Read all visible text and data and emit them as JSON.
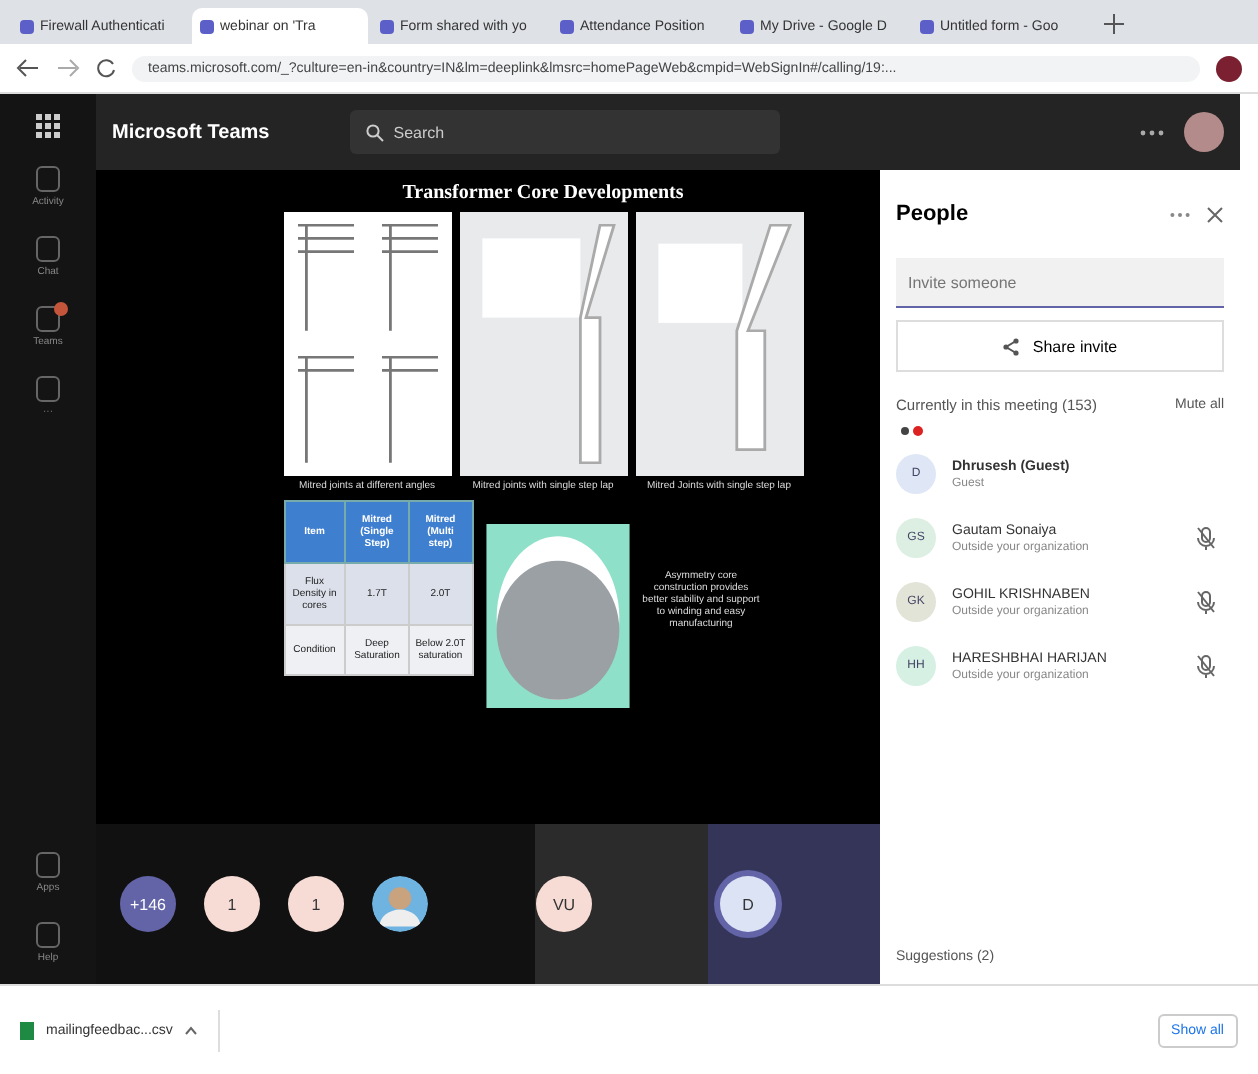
{
  "browser": {
    "tabs": [
      {
        "title": "Firewall Authenticati",
        "selected": false
      },
      {
        "title": "webinar on 'Tra",
        "selected": true
      },
      {
        "title": "Form shared with yo",
        "selected": false
      },
      {
        "title": "Attendance Position",
        "selected": false
      },
      {
        "title": "My Drive - Google D",
        "selected": false
      },
      {
        "title": "Untitled form - Goo",
        "selected": false
      }
    ],
    "url": "teams.microsoft.com/_?culture=en-in&country=IN&lm=deeplink&lmsrc=homePageWeb&cmpid=WebSignIn#/calling/19:..."
  },
  "app": {
    "name": "Microsoft Teams",
    "search_placeholder": "Search"
  },
  "rail": [
    {
      "label": "Activity",
      "badge": false
    },
    {
      "label": "Chat",
      "badge": false
    },
    {
      "label": "Teams",
      "badge": true
    },
    {
      "label": "···",
      "badge": false
    }
  ],
  "rail_bottom": [
    {
      "label": "Apps"
    },
    {
      "label": "Help"
    }
  ],
  "slide": {
    "title": "Transformer Core Developments",
    "captions": [
      "Mitred joints at different angles",
      "Mitred joints with single step lap",
      "Mitred Joints with single step lap"
    ],
    "table": {
      "columns": [
        "Item",
        "Mitred (Single Step)",
        "Mitred (Multi step)"
      ],
      "rows": [
        [
          "Flux Density in cores",
          "1.7T",
          "2.0T"
        ],
        [
          "Condition",
          "Deep Saturation",
          "Below 2.0T saturation"
        ]
      ]
    },
    "note": "Asymmetry core construction provides better stability and support to winding and easy manufacturing"
  },
  "tiles": [
    {
      "kind": "count",
      "text": "+146"
    },
    {
      "kind": "initials",
      "text": "1"
    },
    {
      "kind": "initials",
      "text": "1"
    },
    {
      "kind": "photo"
    },
    {
      "kind": "initials",
      "text": "VU"
    },
    {
      "kind": "speaking",
      "text": "D"
    }
  ],
  "people": {
    "title": "People",
    "invite_placeholder": "Invite someone",
    "share": "Share invite",
    "section": "Currently in this meeting (153)",
    "mute_all": "Mute all",
    "members": [
      {
        "initials": "D",
        "name": "Dhrusesh (Guest)",
        "role": "Guest",
        "muted": false,
        "color": "#dfe6f6"
      },
      {
        "initials": "GS",
        "name": "Gautam Sonaiya",
        "role": "Outside your organization",
        "muted": true,
        "color": "#dcefe2"
      },
      {
        "initials": "GK",
        "name": "GOHIL KRISHNABEN",
        "role": "Outside your organization",
        "muted": true,
        "color": "#e3e4d8"
      },
      {
        "initials": "HH",
        "name": "HARESHBHAI HARIJAN",
        "role": "Outside your organization",
        "muted": true,
        "color": "#d6f0e4"
      }
    ],
    "suggestions": "Suggestions (2)"
  },
  "download": {
    "file": "mailingfeedbac...csv",
    "show_all": "Show all"
  }
}
